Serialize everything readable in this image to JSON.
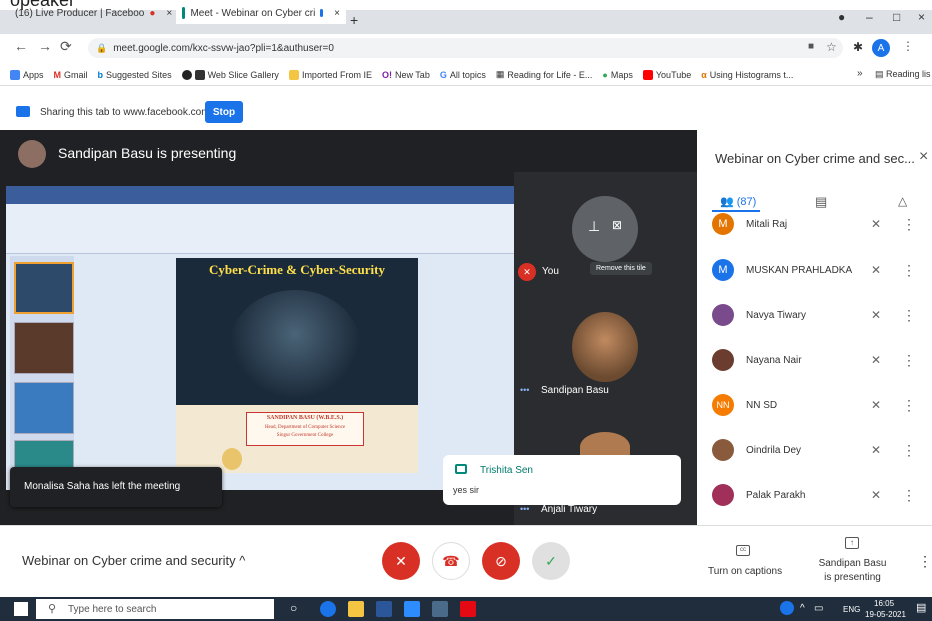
{
  "top_cut_text": "opeaker",
  "tabs": [
    {
      "label": "(16) Live Producer | Faceboo",
      "close": "×"
    },
    {
      "label": "Meet - Webinar on Cyber cri",
      "close": "×"
    }
  ],
  "new_tab": "+",
  "window_controls": {
    "min": "–",
    "max": "□",
    "close": "×"
  },
  "url": "meet.google.com/kxc-ssvw-jao?pli=1&authuser=0",
  "profile_initial": "A",
  "bookmarks": [
    "Apps",
    "Gmail",
    "Suggested Sites",
    "Web Slice Gallery",
    "Imported From IE",
    "New Tab",
    "All topics",
    "Reading for Life - E...",
    "Maps",
    "YouTube",
    "Using Histograms t..."
  ],
  "bookmarks_more": "»",
  "reading_list": "Reading lis",
  "sharing": {
    "text": "Sharing this tab to www.facebook.com",
    "stop": "Stop"
  },
  "presenter_banner": "Sandipan Basu is presenting",
  "slide": {
    "title": "Cyber-Crime & Cyber-Security",
    "name": "SANDIPAN BASU (W.B.E.S.)",
    "line1": "Head, Department of Computer Science",
    "line2": "Singur Government College"
  },
  "tiles": {
    "you": "You",
    "remove_tooltip": "Remove this tile",
    "presenter_name": "Sandipan Basu",
    "third_name": "Anjali Tiwary",
    "dots": "•••"
  },
  "toast": "Monalisa Saha has left the meeting",
  "chat": {
    "sender": "Trishita Sen",
    "message": "yes sir"
  },
  "panel": {
    "title": "Webinar on Cyber crime and sec...",
    "people_count": "(87)",
    "participants": [
      {
        "name": "Mitali Raj",
        "initial": "M",
        "color": "#e37400"
      },
      {
        "name": "MUSKAN PRAHLADKA",
        "initial": "M",
        "color": "#1a73e8"
      },
      {
        "name": "Navya Tiwary",
        "initial": "",
        "color": "#7a4b8c"
      },
      {
        "name": "Nayana Nair",
        "initial": "",
        "color": "#6b3d2e"
      },
      {
        "name": "NN SD",
        "initial": "NN",
        "color": "#f57c00"
      },
      {
        "name": "Oindrila Dey",
        "initial": "",
        "color": "#8a5a3c"
      },
      {
        "name": "Palak Parakh",
        "initial": "",
        "color": "#a0305a"
      }
    ]
  },
  "bottom": {
    "meeting_title": "Webinar on Cyber crime and security",
    "captions": "Turn on captions",
    "cc": "cc",
    "presenting_line1": "Sandipan Basu",
    "presenting_line2": "is presenting"
  },
  "taskbar": {
    "search": "Type here to search",
    "lang": "ENG",
    "time": "16:05",
    "date": "19-05-2021"
  }
}
